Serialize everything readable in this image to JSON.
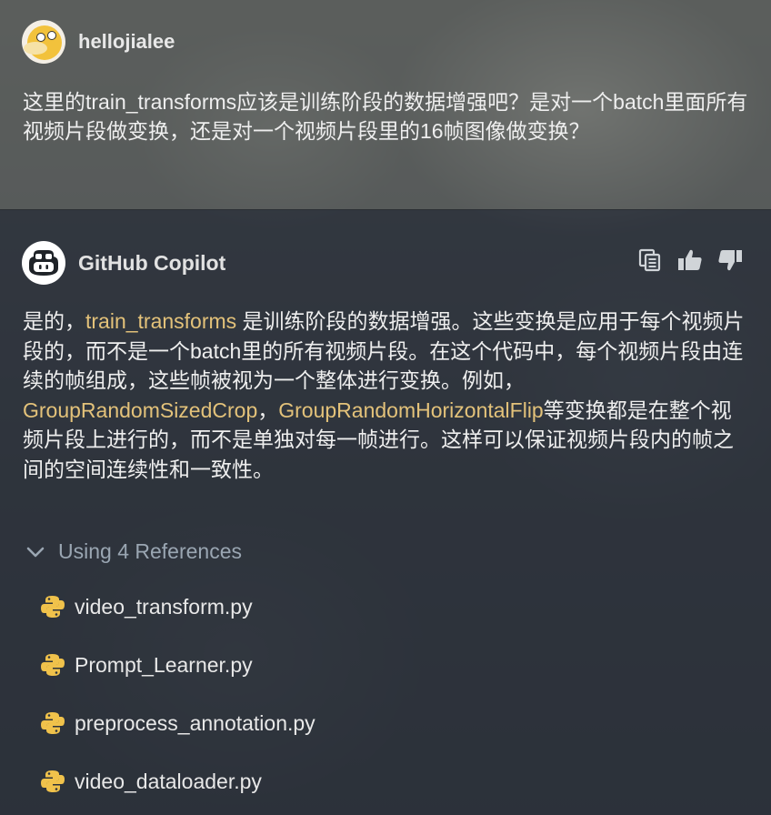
{
  "user": {
    "username": "hellojialee",
    "avatar_icon": "psyduck-avatar-icon",
    "message": "这里的train_transforms应该是训练阶段的数据增强吧？是对一个batch里面所有视频片段做变换，还是对一个视频片段里的16帧图像做变换？"
  },
  "assistant": {
    "name": "GitHub Copilot",
    "avatar_icon": "copilot-icon",
    "actions": [
      {
        "name": "copy-icon"
      },
      {
        "name": "thumbs-up-icon"
      },
      {
        "name": "thumbs-down-icon"
      }
    ],
    "answer": {
      "part1": "是的，",
      "code1": "train_transforms",
      "part2": " 是训练阶段的数据增强。这些变换是应用于每个视频片段的，而不是一个batch里的所有视频片段。在这个代码中，每个视频片段由连续的帧组成，这些帧被视为一个整体进行变换。例如，",
      "code2": "GroupRandomSizedCrop",
      "part3": "，",
      "code3": "GroupRandomHorizontalFlip",
      "part4": "等变换都是在整个视频片段上进行的，而不是单独对每一帧进行。这样可以保证视频片段内的帧之间的空间连续性和一致性。"
    },
    "references": {
      "label": "Using 4 References",
      "files": [
        {
          "name": "video_transform.py",
          "icon": "python-icon"
        },
        {
          "name": "Prompt_Learner.py",
          "icon": "python-icon"
        },
        {
          "name": "preprocess_annotation.py",
          "icon": "python-icon"
        },
        {
          "name": "video_dataloader.py",
          "icon": "python-icon"
        }
      ]
    }
  },
  "colors": {
    "code_highlight": "#e3c27a",
    "references_label": "#9aa6b2",
    "python_icon": "#f0c24b"
  }
}
